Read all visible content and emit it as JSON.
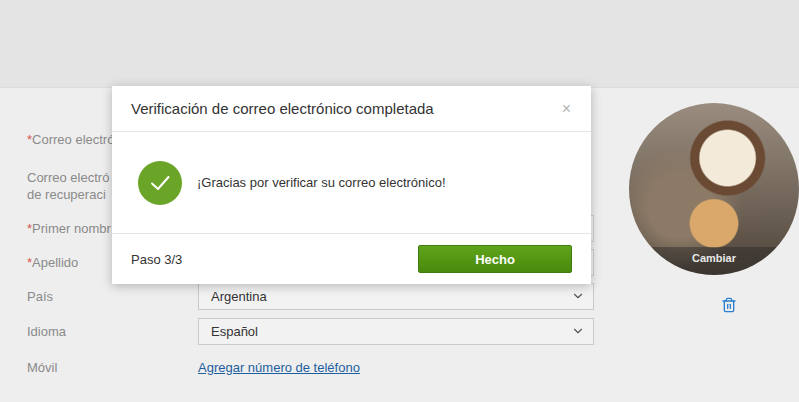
{
  "dialog": {
    "title": "Verificación de correo electrónico completada",
    "close": "×",
    "message": "¡Gracias por verificar su correo electrónico!",
    "step": "Paso 3/3",
    "button": "Hecho"
  },
  "form": {
    "required_marker": "*",
    "fields": [
      {
        "lines": [
          "Correo electró"
        ],
        "required": true,
        "kind": "none",
        "value": ""
      },
      {
        "lines": [
          "Correo electró",
          "de recuperaci"
        ],
        "required": false,
        "kind": "none",
        "value": ""
      },
      {
        "lines": [
          "Primer nombr"
        ],
        "required": true,
        "kind": "text",
        "value": ""
      },
      {
        "lines": [
          "Apellido"
        ],
        "required": true,
        "kind": "text",
        "value": ""
      },
      {
        "lines": [
          "País"
        ],
        "required": false,
        "kind": "select",
        "value": "Argentina"
      },
      {
        "lines": [
          "Idioma"
        ],
        "required": false,
        "kind": "select",
        "value": "Español"
      },
      {
        "lines": [
          "Móvil"
        ],
        "required": false,
        "kind": "link",
        "value": "Agregar número de teléfono"
      }
    ]
  },
  "avatar": {
    "action": "Cambiar"
  }
}
